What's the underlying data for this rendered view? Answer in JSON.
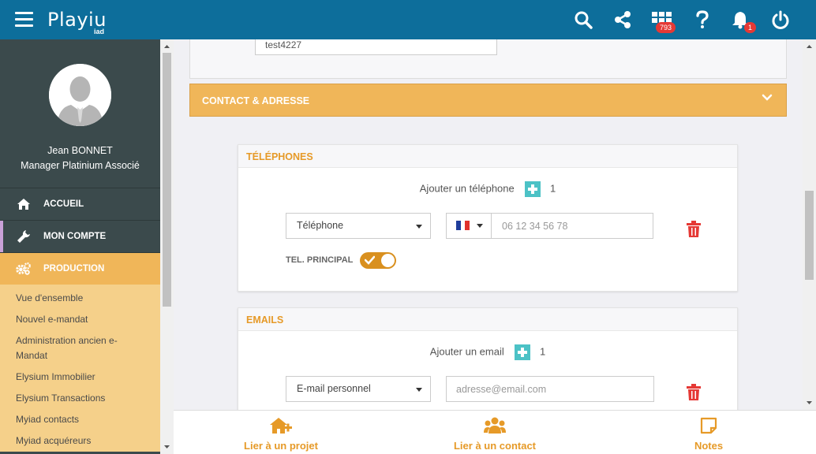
{
  "header": {
    "logo": "Playiu",
    "logo_sub": "iad",
    "icons": [
      "menu-icon",
      "search-icon",
      "share-icon",
      "apps-grid-icon",
      "help-icon",
      "bell-icon",
      "power-icon"
    ],
    "apps_badge": "793",
    "notif_badge": "1"
  },
  "sidebar": {
    "user_name": "Jean BONNET",
    "user_role": "Manager Platinium Associé",
    "items": [
      {
        "label": "ACCUEIL",
        "icon": "home-icon"
      },
      {
        "label": "MON COMPTE",
        "icon": "wrench-icon"
      },
      {
        "label": "PRODUCTION",
        "icon": "gears-icon"
      }
    ],
    "sub_items": [
      "Vue d'ensemble",
      "Nouvel e-mandat",
      "Administration ancien e-Mandat",
      "Elysium Immobilier",
      "Elysium Transactions",
      "Myiad contacts",
      "Myiad acquéreurs"
    ]
  },
  "main": {
    "top_input_value": "test4227",
    "section_title": "CONTACT & ADRESSE",
    "phones": {
      "title": "TÉLÉPHONES",
      "add_label": "Ajouter un téléphone",
      "count": "1",
      "type_selected": "Téléphone",
      "number_placeholder": "06 12 34 56 78",
      "principal_label": "TEL. PRINCIPAL"
    },
    "emails": {
      "title": "EMAILS",
      "add_label": "Ajouter un email",
      "count": "1",
      "type_selected": "E-mail personnel",
      "email_placeholder": "adresse@email.com"
    }
  },
  "bottombar": {
    "items": [
      {
        "label": "Lier à un projet",
        "icon": "home-plus-icon"
      },
      {
        "label": "Lier à un contact",
        "icon": "users-icon"
      },
      {
        "label": "Notes",
        "icon": "note-icon"
      }
    ]
  },
  "colors": {
    "topbar": "#0d6e9b",
    "sidebar": "#3b4a4c",
    "accent_orange": "#f0b659",
    "accent_text": "#e69a28",
    "teal": "#4cc2c6",
    "danger": "#e53935"
  }
}
